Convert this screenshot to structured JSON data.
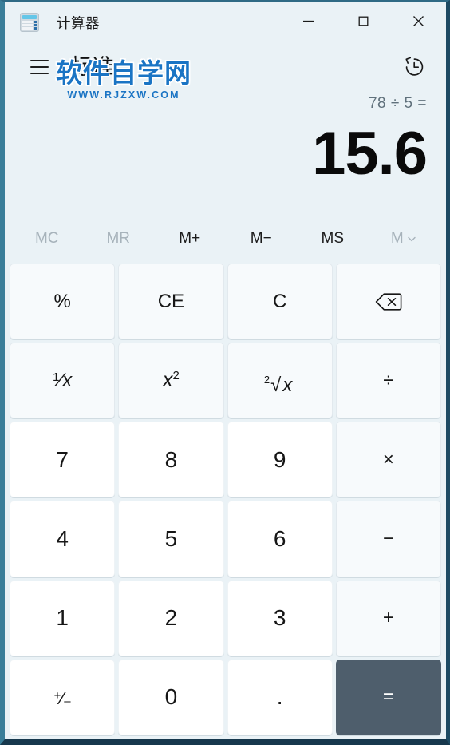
{
  "window": {
    "title": "计算器",
    "app_icon": "calculator-icon",
    "controls": [
      {
        "name": "minimize",
        "glyph": "minimize-icon"
      },
      {
        "name": "maximize",
        "glyph": "maximize-icon"
      },
      {
        "name": "close",
        "glyph": "close-icon"
      }
    ]
  },
  "header": {
    "menu_icon": "hamburger-menu-icon",
    "mode_title": "标准",
    "keep_on_top_icon": "keep-on-top-icon",
    "history_icon": "history-icon"
  },
  "watermark": {
    "main": "软件自学网",
    "url": "WWW.RJZXW.COM"
  },
  "display": {
    "expression": "78 ÷ 5 =",
    "result": "15.6"
  },
  "memory": {
    "buttons": [
      {
        "label": "MC",
        "name": "memory-clear-button",
        "enabled": false
      },
      {
        "label": "MR",
        "name": "memory-recall-button",
        "enabled": false
      },
      {
        "label": "M+",
        "name": "memory-add-button",
        "enabled": true
      },
      {
        "label": "M−",
        "name": "memory-subtract-button",
        "enabled": true
      },
      {
        "label": "MS",
        "name": "memory-store-button",
        "enabled": true
      },
      {
        "label": "M",
        "name": "memory-dropdown-button",
        "enabled": false,
        "chevron": true
      }
    ]
  },
  "keypad": {
    "rows": [
      [
        {
          "label": "%",
          "name": "percent-button",
          "kind": "func"
        },
        {
          "label": "CE",
          "name": "clear-entry-button",
          "kind": "func"
        },
        {
          "label": "C",
          "name": "clear-button",
          "kind": "func"
        },
        {
          "label": "",
          "name": "backspace-button",
          "kind": "func",
          "icon": "backspace-icon"
        }
      ],
      [
        {
          "label": "1/x",
          "name": "reciprocal-button",
          "kind": "func",
          "glyph": "reciprocal"
        },
        {
          "label": "x²",
          "name": "square-button",
          "kind": "func",
          "glyph": "square"
        },
        {
          "label": "²√x",
          "name": "square-root-button",
          "kind": "func",
          "glyph": "sqrt"
        },
        {
          "label": "÷",
          "name": "divide-button",
          "kind": "op"
        }
      ],
      [
        {
          "label": "7",
          "name": "digit-7-button",
          "kind": "digit"
        },
        {
          "label": "8",
          "name": "digit-8-button",
          "kind": "digit"
        },
        {
          "label": "9",
          "name": "digit-9-button",
          "kind": "digit"
        },
        {
          "label": "×",
          "name": "multiply-button",
          "kind": "op"
        }
      ],
      [
        {
          "label": "4",
          "name": "digit-4-button",
          "kind": "digit"
        },
        {
          "label": "5",
          "name": "digit-5-button",
          "kind": "digit"
        },
        {
          "label": "6",
          "name": "digit-6-button",
          "kind": "digit"
        },
        {
          "label": "−",
          "name": "subtract-button",
          "kind": "op"
        }
      ],
      [
        {
          "label": "1",
          "name": "digit-1-button",
          "kind": "digit"
        },
        {
          "label": "2",
          "name": "digit-2-button",
          "kind": "digit"
        },
        {
          "label": "3",
          "name": "digit-3-button",
          "kind": "digit"
        },
        {
          "label": "+",
          "name": "add-button",
          "kind": "op"
        }
      ],
      [
        {
          "label": "+/−",
          "name": "negate-button",
          "kind": "digit",
          "glyph": "plusminus"
        },
        {
          "label": "0",
          "name": "digit-0-button",
          "kind": "digit"
        },
        {
          "label": ".",
          "name": "decimal-button",
          "kind": "digit"
        },
        {
          "label": "=",
          "name": "equals-button",
          "kind": "equals"
        }
      ]
    ]
  },
  "colors": {
    "window_background": "#eaf2f6",
    "digit_key": "#ffffff",
    "function_key": "#f7fafc",
    "equals_key": "#4e5e6c",
    "accent_border": "#3a7e99",
    "watermark_blue": "#1a74c4",
    "disabled_text": "#a7b3bb"
  }
}
